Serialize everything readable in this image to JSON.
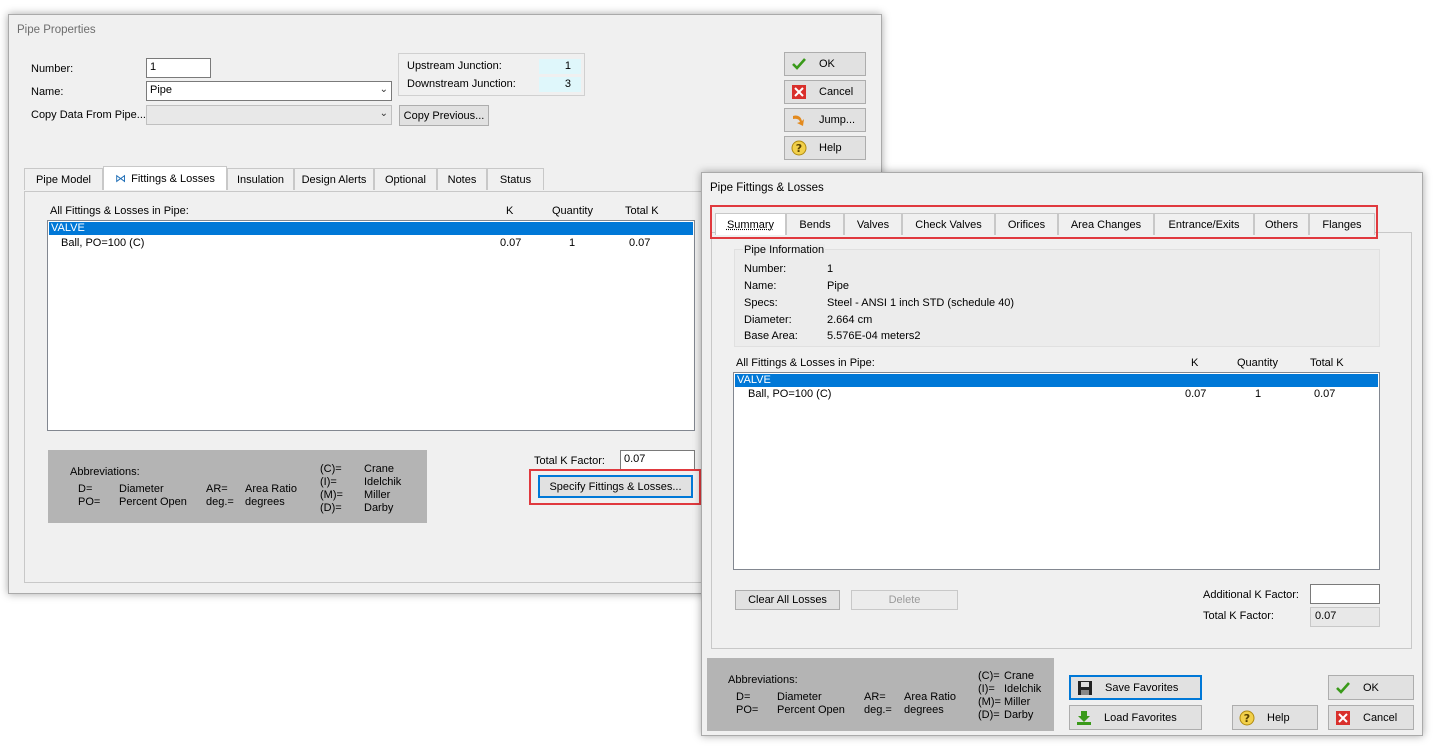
{
  "pipe_properties": {
    "title": "Pipe Properties",
    "number_label": "Number:",
    "number_value": "1",
    "name_label": "Name:",
    "name_value": "Pipe",
    "copy_label": "Copy Data From Pipe...",
    "copy_value": "",
    "copy_previous_label": "Copy Previous...",
    "upstream_label": "Upstream Junction:",
    "upstream_value": "1",
    "downstream_label": "Downstream Junction:",
    "downstream_value": "3",
    "buttons": {
      "ok": "OK",
      "cancel": "Cancel",
      "jump": "Jump...",
      "help": "Help"
    },
    "tabs": [
      "Pipe Model",
      "Fittings & Losses",
      "Insulation",
      "Design Alerts",
      "Optional",
      "Notes",
      "Status"
    ],
    "list_header": {
      "all": "All Fittings & Losses in Pipe:",
      "k": "K",
      "quantity": "Quantity",
      "total_k": "Total K"
    },
    "list_rows": [
      {
        "name": "VALVE",
        "k": "",
        "quantity": "",
        "total_k": "",
        "selected": true
      },
      {
        "name": "Ball, PO=100 (C)",
        "k": "0.07",
        "quantity": "1",
        "total_k": "0.07",
        "selected": false
      }
    ],
    "total_k_label": "Total K Factor:",
    "total_k_value": "0.07",
    "specify_button": "Specify Fittings & Losses...",
    "abbreviations": {
      "title": "Abbreviations:",
      "d_key": "D=",
      "d_val": "Diameter",
      "po_key": "PO=",
      "po_val": "Percent Open",
      "ar_key": "AR=",
      "ar_val": "Area Ratio",
      "deg_key": "deg.=",
      "deg_val": "degrees",
      "c_key": "(C)=",
      "c_val": "Crane",
      "i_key": "(I)=",
      "i_val": "Idelchik",
      "m_key": "(M)=",
      "m_val": "Miller",
      "dd_key": "(D)=",
      "dd_val": "Darby"
    }
  },
  "fittings_dialog": {
    "title": "Pipe Fittings & Losses",
    "tabs": [
      "Summary",
      "Bends",
      "Valves",
      "Check Valves",
      "Orifices",
      "Area Changes",
      "Entrance/Exits",
      "Others",
      "Flanges"
    ],
    "pipe_info": {
      "title": "Pipe Information",
      "number_label": "Number:",
      "number_value": "1",
      "name_label": "Name:",
      "name_value": "Pipe",
      "specs_label": "Specs:",
      "specs_value": "Steel - ANSI 1 inch STD (schedule 40)",
      "diameter_label": "Diameter:",
      "diameter_value": "2.664 cm",
      "area_label": "Base Area:",
      "area_value": "5.576E-04 meters2"
    },
    "list_header": {
      "all": "All Fittings & Losses in Pipe:",
      "k": "K",
      "quantity": "Quantity",
      "total_k": "Total K"
    },
    "list_rows": [
      {
        "name": "VALVE",
        "k": "",
        "quantity": "",
        "total_k": "",
        "selected": true
      },
      {
        "name": "Ball, PO=100 (C)",
        "k": "0.07",
        "quantity": "1",
        "total_k": "0.07",
        "selected": false
      }
    ],
    "clear_button": "Clear All Losses",
    "delete_button": "Delete",
    "additional_k_label": "Additional K Factor:",
    "additional_k_value": "",
    "total_k_label": "Total K Factor:",
    "total_k_value": "0.07",
    "save_favorites": "Save Favorites",
    "load_favorites": "Load Favorites",
    "help": "Help",
    "ok": "OK",
    "cancel": "Cancel",
    "abbreviations": {
      "title": "Abbreviations:",
      "d_key": "D=",
      "d_val": "Diameter",
      "po_key": "PO=",
      "po_val": "Percent Open",
      "ar_key": "AR=",
      "ar_val": "Area Ratio",
      "deg_key": "deg.=",
      "deg_val": "degrees",
      "c_key": "(C)=",
      "c_val": "Crane",
      "i_key": "(I)=",
      "i_val": "Idelchik",
      "m_key": "(M)=",
      "m_val": "Miller",
      "dd_key": "(D)=",
      "dd_val": "Darby"
    }
  },
  "colors": {
    "selection": "#0078d7",
    "highlight": "#e0393e",
    "window_bg": "#f0f0f0",
    "abbr_bg": "#b4b4b4",
    "junction_bg": "#dff7fb"
  }
}
